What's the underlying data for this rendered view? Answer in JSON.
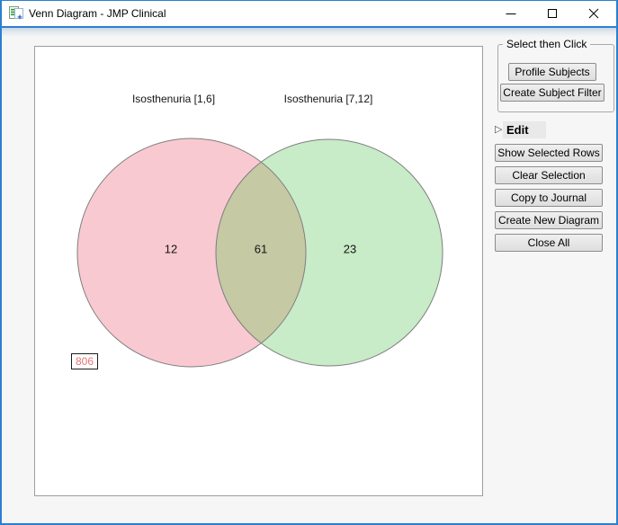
{
  "window": {
    "title": "Venn Diagram - JMP Clinical"
  },
  "venn": {
    "left_set_label": "Isosthenuria [1,6]",
    "right_set_label": "Isosthenuria [7,12]",
    "counts": {
      "left_only": "12",
      "intersection": "61",
      "right_only": "23",
      "outside": "806"
    },
    "colors": {
      "left_fill": "#f9c9d1",
      "right_fill": "#c8ebc8",
      "overlap_fill": "#c5c9a4",
      "circle_stroke": "#7e7e7e",
      "outside_text": "#e87474"
    }
  },
  "panel": {
    "group": {
      "title": "Select then Click",
      "buttons": [
        {
          "label": "Profile Subjects"
        },
        {
          "label": "Create Subject Filter"
        }
      ]
    },
    "edit": {
      "disclosure_glyph": "▷",
      "label": "Edit"
    },
    "buttons": [
      {
        "label": "Show Selected Rows"
      },
      {
        "label": "Clear Selection"
      },
      {
        "label": "Copy to Journal"
      },
      {
        "label": "Create New Diagram"
      },
      {
        "label": "Close All"
      }
    ]
  }
}
